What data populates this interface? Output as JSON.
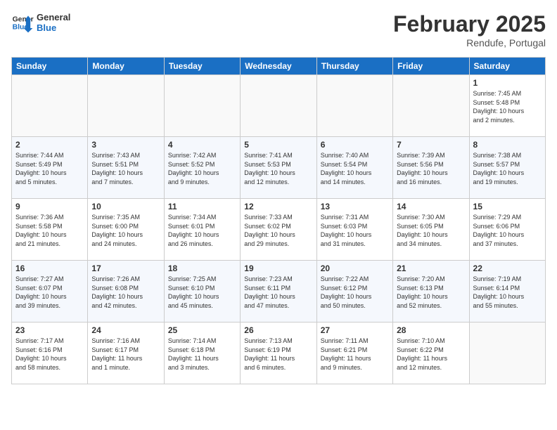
{
  "logo": {
    "line1": "General",
    "line2": "Blue"
  },
  "title": "February 2025",
  "location": "Rendufe, Portugal",
  "weekdays": [
    "Sunday",
    "Monday",
    "Tuesday",
    "Wednesday",
    "Thursday",
    "Friday",
    "Saturday"
  ],
  "weeks": [
    [
      {
        "day": "",
        "info": ""
      },
      {
        "day": "",
        "info": ""
      },
      {
        "day": "",
        "info": ""
      },
      {
        "day": "",
        "info": ""
      },
      {
        "day": "",
        "info": ""
      },
      {
        "day": "",
        "info": ""
      },
      {
        "day": "1",
        "info": "Sunrise: 7:45 AM\nSunset: 5:48 PM\nDaylight: 10 hours\nand 2 minutes."
      }
    ],
    [
      {
        "day": "2",
        "info": "Sunrise: 7:44 AM\nSunset: 5:49 PM\nDaylight: 10 hours\nand 5 minutes."
      },
      {
        "day": "3",
        "info": "Sunrise: 7:43 AM\nSunset: 5:51 PM\nDaylight: 10 hours\nand 7 minutes."
      },
      {
        "day": "4",
        "info": "Sunrise: 7:42 AM\nSunset: 5:52 PM\nDaylight: 10 hours\nand 9 minutes."
      },
      {
        "day": "5",
        "info": "Sunrise: 7:41 AM\nSunset: 5:53 PM\nDaylight: 10 hours\nand 12 minutes."
      },
      {
        "day": "6",
        "info": "Sunrise: 7:40 AM\nSunset: 5:54 PM\nDaylight: 10 hours\nand 14 minutes."
      },
      {
        "day": "7",
        "info": "Sunrise: 7:39 AM\nSunset: 5:56 PM\nDaylight: 10 hours\nand 16 minutes."
      },
      {
        "day": "8",
        "info": "Sunrise: 7:38 AM\nSunset: 5:57 PM\nDaylight: 10 hours\nand 19 minutes."
      }
    ],
    [
      {
        "day": "9",
        "info": "Sunrise: 7:36 AM\nSunset: 5:58 PM\nDaylight: 10 hours\nand 21 minutes."
      },
      {
        "day": "10",
        "info": "Sunrise: 7:35 AM\nSunset: 6:00 PM\nDaylight: 10 hours\nand 24 minutes."
      },
      {
        "day": "11",
        "info": "Sunrise: 7:34 AM\nSunset: 6:01 PM\nDaylight: 10 hours\nand 26 minutes."
      },
      {
        "day": "12",
        "info": "Sunrise: 7:33 AM\nSunset: 6:02 PM\nDaylight: 10 hours\nand 29 minutes."
      },
      {
        "day": "13",
        "info": "Sunrise: 7:31 AM\nSunset: 6:03 PM\nDaylight: 10 hours\nand 31 minutes."
      },
      {
        "day": "14",
        "info": "Sunrise: 7:30 AM\nSunset: 6:05 PM\nDaylight: 10 hours\nand 34 minutes."
      },
      {
        "day": "15",
        "info": "Sunrise: 7:29 AM\nSunset: 6:06 PM\nDaylight: 10 hours\nand 37 minutes."
      }
    ],
    [
      {
        "day": "16",
        "info": "Sunrise: 7:27 AM\nSunset: 6:07 PM\nDaylight: 10 hours\nand 39 minutes."
      },
      {
        "day": "17",
        "info": "Sunrise: 7:26 AM\nSunset: 6:08 PM\nDaylight: 10 hours\nand 42 minutes."
      },
      {
        "day": "18",
        "info": "Sunrise: 7:25 AM\nSunset: 6:10 PM\nDaylight: 10 hours\nand 45 minutes."
      },
      {
        "day": "19",
        "info": "Sunrise: 7:23 AM\nSunset: 6:11 PM\nDaylight: 10 hours\nand 47 minutes."
      },
      {
        "day": "20",
        "info": "Sunrise: 7:22 AM\nSunset: 6:12 PM\nDaylight: 10 hours\nand 50 minutes."
      },
      {
        "day": "21",
        "info": "Sunrise: 7:20 AM\nSunset: 6:13 PM\nDaylight: 10 hours\nand 52 minutes."
      },
      {
        "day": "22",
        "info": "Sunrise: 7:19 AM\nSunset: 6:14 PM\nDaylight: 10 hours\nand 55 minutes."
      }
    ],
    [
      {
        "day": "23",
        "info": "Sunrise: 7:17 AM\nSunset: 6:16 PM\nDaylight: 10 hours\nand 58 minutes."
      },
      {
        "day": "24",
        "info": "Sunrise: 7:16 AM\nSunset: 6:17 PM\nDaylight: 11 hours\nand 1 minute."
      },
      {
        "day": "25",
        "info": "Sunrise: 7:14 AM\nSunset: 6:18 PM\nDaylight: 11 hours\nand 3 minutes."
      },
      {
        "day": "26",
        "info": "Sunrise: 7:13 AM\nSunset: 6:19 PM\nDaylight: 11 hours\nand 6 minutes."
      },
      {
        "day": "27",
        "info": "Sunrise: 7:11 AM\nSunset: 6:21 PM\nDaylight: 11 hours\nand 9 minutes."
      },
      {
        "day": "28",
        "info": "Sunrise: 7:10 AM\nSunset: 6:22 PM\nDaylight: 11 hours\nand 12 minutes."
      },
      {
        "day": "",
        "info": ""
      }
    ]
  ]
}
